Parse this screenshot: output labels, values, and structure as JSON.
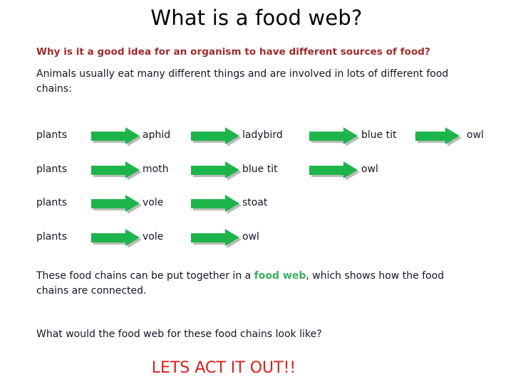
{
  "slide": {
    "title": "What is a food web?",
    "intro_question": "Why is it a good idea for an organism to have different sources of food?",
    "intro_statement": "Animals usually eat many different things and are involved in lots of different food chains:",
    "closing_paragraph_before": "These food chains can be put together in a ",
    "closing_paragraph_highlight": "food web",
    "closing_paragraph_after": ", which shows how the food chains are connected.",
    "closing_question": "What would the food web for these food chains look like?",
    "call_to_action": "LETS ACT IT OUT!!"
  },
  "colors": {
    "title": "#000000",
    "question_red": "#9E2A2B",
    "body_text": "#141428",
    "arrow_green": "#1DB54B",
    "highlight_green": "#3BAE5E",
    "cta_red": "#D8201E",
    "arrow_shadow": "#b9bcb9",
    "background": "#ffffff"
  },
  "food_chains": {
    "columns_x": [
      51,
      200,
      340,
      507,
      655
    ],
    "arrows_x": [
      128,
      268,
      434,
      583
    ],
    "rows": [
      {
        "organisms": [
          "plants",
          "aphid",
          "ladybird",
          "blue tit",
          "owl"
        ],
        "arrow_count": 4
      },
      {
        "organisms": [
          "plants",
          "moth",
          "blue tit",
          "owl"
        ],
        "arrow_count": 3
      },
      {
        "organisms": [
          "plants",
          "vole",
          "stoat"
        ],
        "arrow_count": 2
      },
      {
        "organisms": [
          "plants",
          "vole",
          "owl"
        ],
        "arrow_count": 2
      }
    ]
  }
}
